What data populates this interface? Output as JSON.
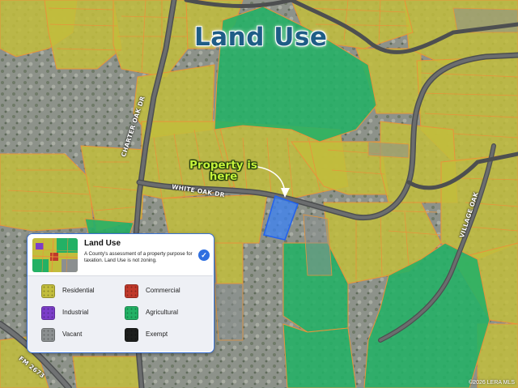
{
  "map": {
    "title": "Land Use",
    "property_label_line1": "Property is",
    "property_label_line2": "here",
    "roads": {
      "charter_oak": "CHARTER OAK DR",
      "white_oak": "WHITE OAK DR",
      "village_oak": "VILLAGE OAK",
      "fm": "FM 2673"
    },
    "copyright": "©2026 LERA MLS",
    "colors": {
      "residential": "#c2bd3c",
      "agricultural": "#23b165",
      "commercial": "#c0392b",
      "industrial": "#7c3ec9",
      "vacant": "#8b8f90",
      "exempt": "#1d1f1d",
      "parcel_outline": "#e8943a",
      "selected_property": "#3b82f6",
      "title_text": "#1f5d86",
      "property_label": "#c6f23a"
    }
  },
  "legend": {
    "title": "Land Use",
    "description": "A County's assessment of a property purpose for taxation. Land Use is not zoning.",
    "items": [
      {
        "label": "Residential",
        "color": "#c2bd3c"
      },
      {
        "label": "Commercial",
        "color": "#c0392b"
      },
      {
        "label": "Industrial",
        "color": "#7c3ec9"
      },
      {
        "label": "Agricultural",
        "color": "#23b165"
      },
      {
        "label": "Vacant",
        "color": "#8b8f90"
      },
      {
        "label": "Exempt",
        "color": "#1d1f1d"
      }
    ],
    "selected_icon": "checkmark-icon"
  }
}
